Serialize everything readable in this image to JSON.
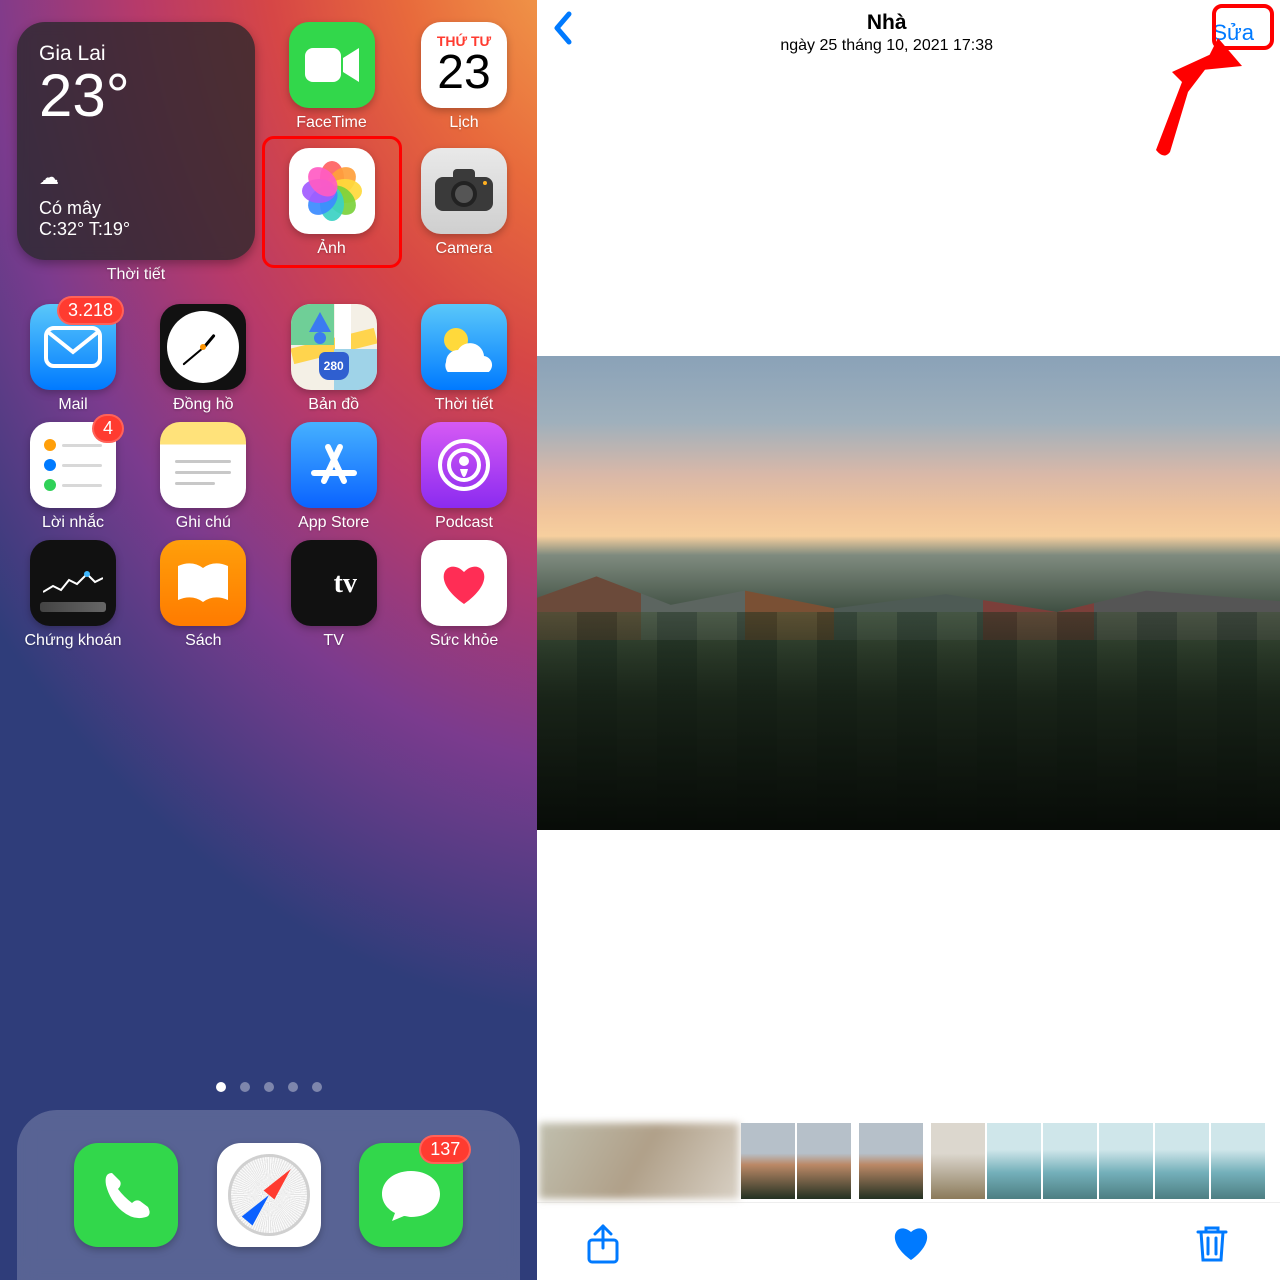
{
  "homescreen": {
    "weather": {
      "location": "Gia Lai",
      "temp": "23°",
      "condition": "Có mây",
      "hi_lo": "C:32° T:19°",
      "widget_label": "Thời tiết"
    },
    "apps": {
      "facetime": "FaceTime",
      "calendar": {
        "label": "Lịch",
        "dow": "THỨ TƯ",
        "daynum": "23"
      },
      "photos": "Ảnh",
      "camera": "Camera",
      "mail": {
        "label": "Mail",
        "badge": "3.218"
      },
      "clock": "Đồng hồ",
      "maps": {
        "label": "Bản đồ",
        "route": "280"
      },
      "weather": "Thời tiết",
      "reminders": {
        "label": "Lời nhắc",
        "badge": "4"
      },
      "notes": "Ghi chú",
      "appstore": "App Store",
      "podcast": "Podcast",
      "stocks": "Chứng khoán",
      "books": "Sách",
      "tv": {
        "label": "TV",
        "glyph": "tv"
      },
      "health": "Sức khỏe"
    },
    "dock": {
      "messages_badge": "137"
    }
  },
  "photoview": {
    "title": "Nhà",
    "subtitle": "ngày 25 tháng 10, 2021  17:38",
    "edit": "Sửa"
  }
}
